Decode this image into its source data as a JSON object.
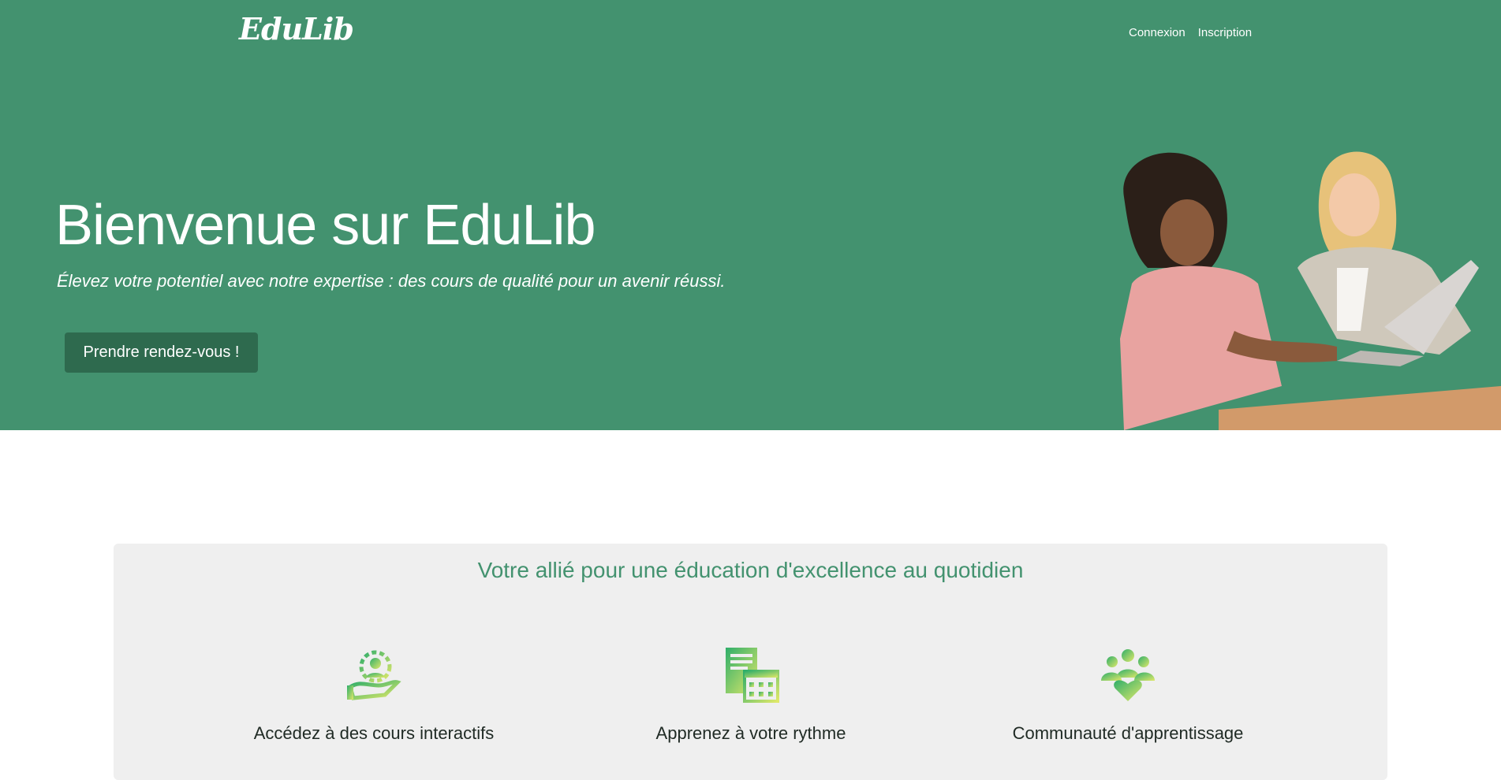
{
  "navbar": {
    "logo": "EduLib",
    "links": [
      {
        "label": "Connexion"
      },
      {
        "label": "Inscription"
      }
    ]
  },
  "hero": {
    "title": "Bienvenue sur EduLib",
    "subtitle": "Élevez votre potentiel avec notre expertise : des cours de qualité pour un avenir réussi.",
    "cta_label": "Prendre rendez-vous !"
  },
  "features": {
    "title": "Votre allié pour une éducation d'excellence au quotidien",
    "items": [
      {
        "icon": "teacher-gear-hand-icon",
        "label": "Accédez à des cours interactifs"
      },
      {
        "icon": "calendar-documents-icon",
        "label": "Apprenez à votre rythme"
      },
      {
        "icon": "community-heart-icon",
        "label": "Communauté d'apprentissage"
      }
    ]
  },
  "colors": {
    "primary": "#43926f",
    "button": "#2e6a4e",
    "panel_bg": "#efefef",
    "icon_gradient_start": "#2fae6a",
    "icon_gradient_end": "#dfe86a"
  }
}
